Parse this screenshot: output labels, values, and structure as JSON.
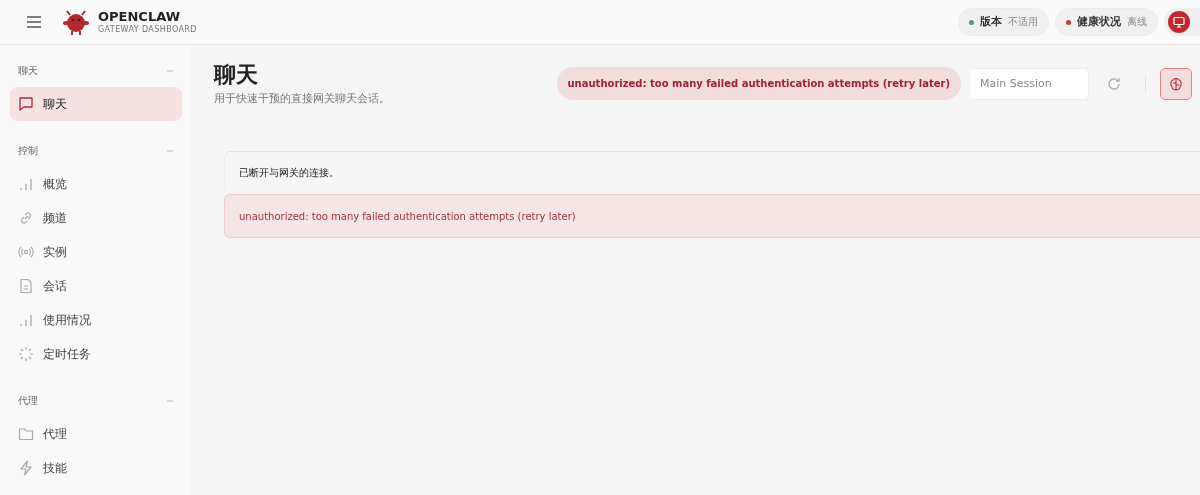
{
  "header": {
    "brand": "OPENCLAW",
    "subtitle": "GATEWAY DASHBOARD",
    "pills": [
      {
        "label": "版本",
        "value": "不适用",
        "color": "#4f9a6a"
      },
      {
        "label": "健康状况",
        "value": "离线",
        "color": "#c8343c"
      }
    ]
  },
  "sidebar": {
    "sections": [
      {
        "title": "聊天",
        "items": [
          {
            "label": "聊天",
            "kind": "chat",
            "selected": true
          }
        ]
      },
      {
        "title": "控制",
        "items": [
          {
            "label": "概览",
            "kind": "bars",
            "selected": false
          },
          {
            "label": "频道",
            "kind": "link",
            "selected": false
          },
          {
            "label": "实例",
            "kind": "radio",
            "selected": false
          },
          {
            "label": "会话",
            "kind": "doc",
            "selected": false
          },
          {
            "label": "使用情况",
            "kind": "bars",
            "selected": false
          },
          {
            "label": "定时任务",
            "kind": "spinner",
            "selected": false
          }
        ]
      },
      {
        "title": "代理",
        "items": [
          {
            "label": "代理",
            "kind": "folder",
            "selected": false
          },
          {
            "label": "技能",
            "kind": "bolt",
            "selected": false
          }
        ]
      }
    ]
  },
  "page": {
    "title": "聊天",
    "subtitle": "用于快速干预的直接网关聊天会话。",
    "error_pill": "unauthorized: too many failed authentication attempts (retry later)",
    "session": {
      "value": "Main Session"
    }
  },
  "messages": [
    {
      "kind": "info",
      "text": "已断开与网关的连接。"
    },
    {
      "kind": "error",
      "text": "unauthorized: too many failed authentication attempts (retry later)"
    }
  ]
}
